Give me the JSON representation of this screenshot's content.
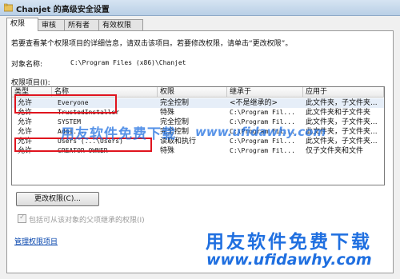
{
  "window": {
    "title": "Chanjet 的高级安全设置"
  },
  "tabs": [
    "权限",
    "审核",
    "所有者",
    "有效权限"
  ],
  "instructions": "若要查看某个权限项目的详细信息，请双击该项目。若要修改权限，请单击“更改权限”。",
  "object": {
    "label": "对象名称:",
    "value": "C:\\Program Files (x86)\\Chanjet"
  },
  "entries_label": "权限项目(I):",
  "columns": [
    "类型",
    "名称",
    "权限",
    "继承于",
    "应用于"
  ],
  "rows": [
    {
      "type": "允许",
      "name": "Everyone",
      "perm": "完全控制",
      "inherit": "<不是继承的>",
      "apply": "此文件夹，子文件夹..."
    },
    {
      "type": "允许",
      "name": "TrustedInstaller",
      "perm": "特殊",
      "inherit": "C:\\Program Fil...",
      "apply": "此文件夹和子文件夹"
    },
    {
      "type": "允许",
      "name": "SYSTEM",
      "perm": "完全控制",
      "inherit": "C:\\Program Fil...",
      "apply": "此文件夹，子文件夹..."
    },
    {
      "type": "允许",
      "name": "Admi...",
      "perm": "完全控制",
      "inherit": "C:\\Program Fil...",
      "apply": "此文件夹，子文件夹..."
    },
    {
      "type": "允许",
      "name": "Users (...\\Users)",
      "perm": "读取和执行",
      "inherit": "C:\\Program Fil...",
      "apply": "此文件夹，子文件夹..."
    },
    {
      "type": "允许",
      "name": "CREATOR OWNER",
      "perm": "特殊",
      "inherit": "C:\\Program Fil...",
      "apply": "仅子文件夹和文件"
    }
  ],
  "buttons": {
    "change_permissions": "更改权限(C)..."
  },
  "checkbox": {
    "label": "包括可从该对象的父项继承的权限(I)"
  },
  "link": "管理权限项目",
  "watermark": {
    "text1": "用友软件免费下载",
    "url": "www.ufidawhy.com"
  },
  "colors": {
    "highlight_box": "#e0141e",
    "watermark_blue": "#1f6fe0",
    "link": "#0645ad"
  }
}
